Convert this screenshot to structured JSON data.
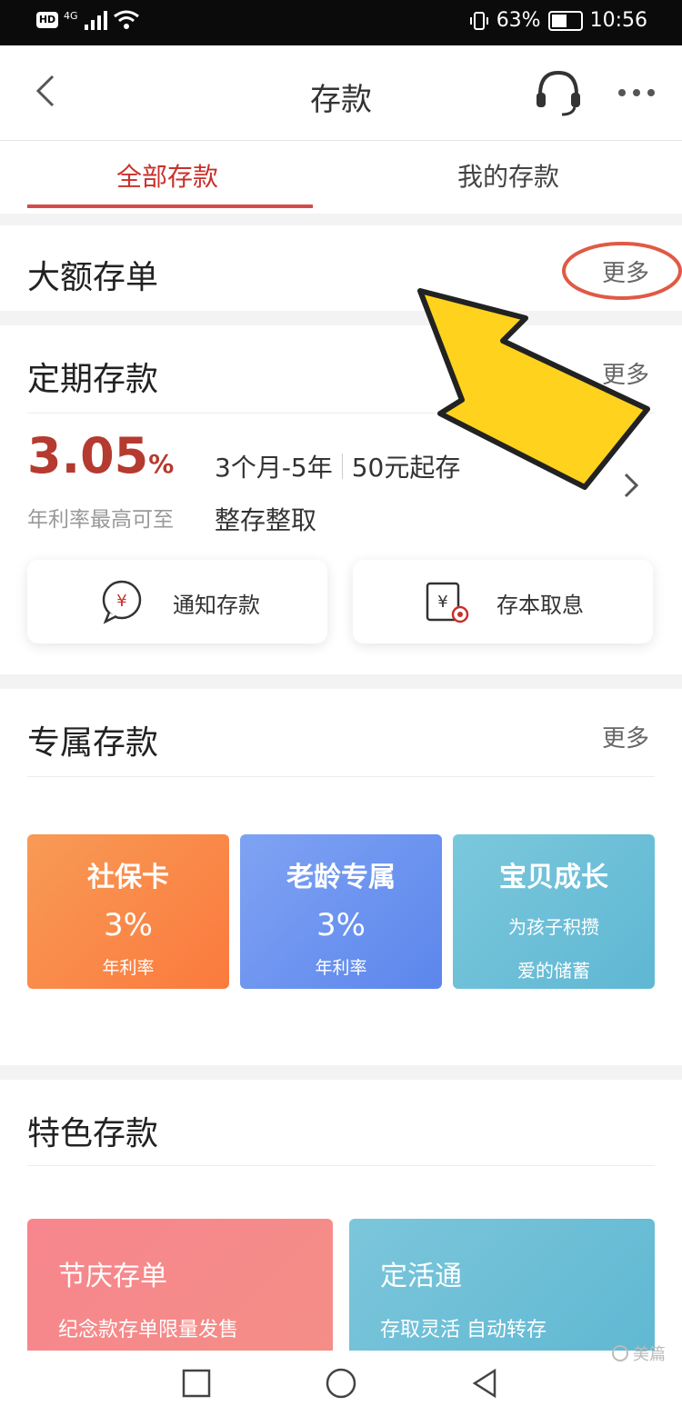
{
  "status_bar": {
    "hd": "HD",
    "network": "4G",
    "battery_percent": "63%",
    "battery_level": 0.63,
    "time": "10:56"
  },
  "header": {
    "title": "存款",
    "icons": {
      "back": "back-arrow-icon",
      "support": "headset-icon",
      "menu": "more-dots-icon"
    }
  },
  "tabs": [
    {
      "label": "全部存款",
      "active": true
    },
    {
      "label": "我的存款",
      "active": false
    }
  ],
  "large_cd": {
    "title": "大额存单",
    "more": "更多"
  },
  "fixed": {
    "title": "定期存款",
    "more": "更多",
    "rate_value": "3.05",
    "rate_unit": "%",
    "rate_caption": "年利率最高可至",
    "term": "3个月-5年",
    "min_amount": "50元起存",
    "type": "整存整取",
    "actions": [
      {
        "label": "通知存款",
        "icon": "yen-bubble-icon"
      },
      {
        "label": "存本取息",
        "icon": "yen-document-icon"
      }
    ]
  },
  "exclusive": {
    "title": "专属存款",
    "more": "更多",
    "tiles": [
      {
        "title": "社保卡",
        "rate": "3%",
        "caption": "年利率",
        "color": "#fb8a4a"
      },
      {
        "title": "老龄专属",
        "rate": "3%",
        "caption": "年利率",
        "color": "#6d95f0"
      },
      {
        "title": "宝贝成长",
        "line1": "为孩子积攒",
        "line2": "爱的储蓄",
        "color": "#6dc0d8"
      }
    ]
  },
  "featured": {
    "title": "特色存款",
    "cards": [
      {
        "title": "节庆存单",
        "subtitle": "纪念款存单限量发售",
        "color": "#f57e86"
      },
      {
        "title": "定活通",
        "subtitle": "存取灵活 自动转存",
        "color": "#6ac0d6"
      }
    ]
  },
  "nav": {
    "buttons": [
      "square-icon",
      "circle-icon",
      "triangle-back-icon"
    ]
  },
  "watermark": {
    "text": "美篇"
  },
  "annotation": {
    "arrow": "yellow-arrow-icon",
    "circle_color": "#e05a45",
    "arrow_color": "#ffd21e"
  }
}
